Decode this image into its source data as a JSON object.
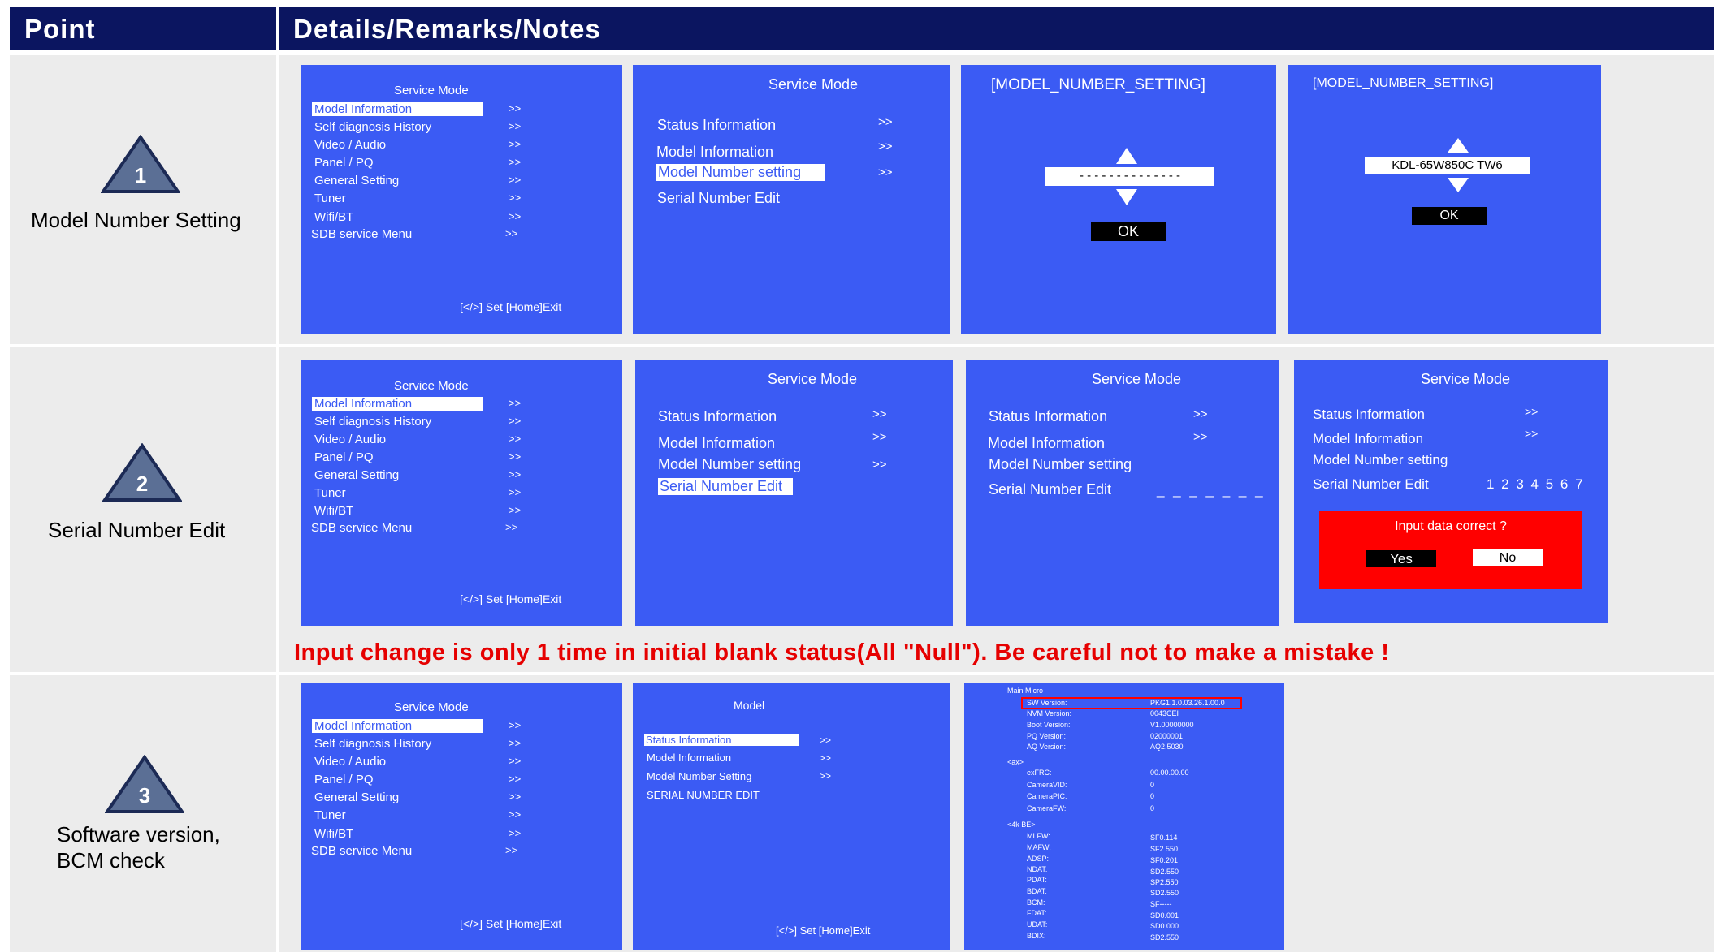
{
  "header": {
    "col1": "Point",
    "col2": "Details/Remarks/Notes"
  },
  "rows": [
    {
      "number": "1",
      "label": "Model Number Setting"
    },
    {
      "number": "2",
      "label": "Serial Number Edit"
    },
    {
      "number": "3",
      "label_line1": "Software version,",
      "label_line2": "BCM check"
    }
  ],
  "warning": "Input change is only 1 time in initial blank status(All \"Null\"). Be careful not to make a mistake !",
  "menu_a": {
    "title": "Service Mode",
    "items": [
      "Model Information",
      "Self diagnosis History",
      "Video / Audio",
      "Panel / PQ",
      "General Setting",
      "Tuner",
      "Wifi/BT",
      "SDB service Menu"
    ],
    "arrow": ">>",
    "footer": "[</>] Set [Home]Exit"
  },
  "menu_b": {
    "title": "Service Mode",
    "items": [
      "Status Information",
      "Model Information",
      "Model Number setting",
      "Serial Number Edit"
    ],
    "arrow": ">>"
  },
  "mns_title": "[MODEL_NUMBER_SETTING]",
  "mns_blank": "- - - - - - - - - - - - - -",
  "mns_value": "KDL-65W850C TW6",
  "ok": "OK",
  "serial_blank": "_ _ _ _ _ _ _",
  "serial_value": "1 2 3 4 5 6 7",
  "dialog": {
    "question": "Input data correct ?",
    "yes": "Yes",
    "no": "No"
  },
  "model_menu": {
    "title": "Model",
    "items": [
      "Status Information",
      "Model Information",
      "Model Number Setting",
      "SERIAL NUMBER EDIT"
    ],
    "footer": "[</>] Set [Home]Exit"
  },
  "sw_info": {
    "section_main": "Main Micro",
    "main": [
      {
        "k": "SW Version:",
        "v": "PKG1.1.0.03.26.1.00.0"
      },
      {
        "k": "NVM Version:",
        "v": "0043CEI"
      },
      {
        "k": "Boot Version:",
        "v": "V1.00000000"
      },
      {
        "k": "PQ Version:",
        "v": "02000001"
      },
      {
        "k": "AQ Version:",
        "v": "AQ2.5030"
      }
    ],
    "section_ax": "<ax>",
    "ax": [
      {
        "k": "exFRC:",
        "v": "00.00.00.00"
      },
      {
        "k": "CameraVID:",
        "v": "0"
      },
      {
        "k": "CameraPIC:",
        "v": "0"
      },
      {
        "k": "CameraFW:",
        "v": "0"
      }
    ],
    "section_be": "<4k BE>",
    "be": [
      {
        "k": "MLFW:",
        "v": "SF0.114"
      },
      {
        "k": "MAFW:",
        "v": "SF2.550"
      },
      {
        "k": "ADSP:",
        "v": "SF0.201"
      },
      {
        "k": "NDAT:",
        "v": "SD2.550"
      },
      {
        "k": "PDAT:",
        "v": "SP2.550"
      },
      {
        "k": "BDAT:",
        "v": "SD2.550"
      },
      {
        "k": "BCM:",
        "v": "SF-----"
      },
      {
        "k": "FDAT:",
        "v": "SD0.001"
      },
      {
        "k": "UDAT:",
        "v": "SD0.000"
      },
      {
        "k": "BDIX:",
        "v": "SD2.550"
      }
    ]
  },
  "colors": {
    "header_bg": "#0b1560",
    "screen_bg": "#3b5bf4",
    "cell_bg": "#ececec",
    "warning": "#e60000",
    "dialog_bg": "#ff0000"
  }
}
